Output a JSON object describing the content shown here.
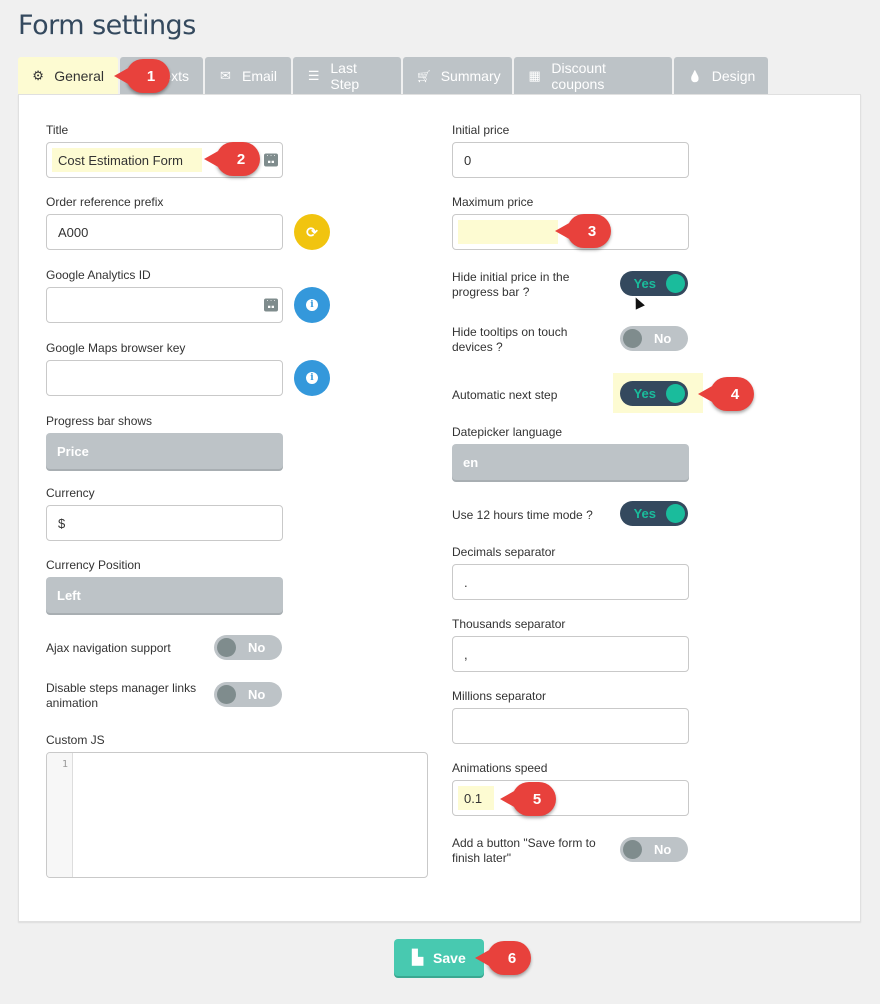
{
  "page": {
    "title": "Form settings"
  },
  "tabs": [
    {
      "label": "General",
      "icon": "gear-icon",
      "glyph": "⚙",
      "active": true
    },
    {
      "label": "Texts",
      "icon": "text-icon",
      "glyph": "",
      "active": false
    },
    {
      "label": "Email",
      "icon": "envelope-icon",
      "glyph": "✉",
      "active": false
    },
    {
      "label": "Last Step",
      "icon": "list-icon",
      "glyph": "☰",
      "active": false
    },
    {
      "label": "Summary",
      "icon": "cart-icon",
      "glyph": "🛒",
      "active": false
    },
    {
      "label": "Discount coupons",
      "icon": "gift-icon",
      "glyph": "▦",
      "active": false
    },
    {
      "label": "Design",
      "icon": "droplet-icon",
      "glyph": "💧",
      "active": false
    }
  ],
  "left": {
    "title": {
      "label": "Title",
      "value": "Cost Estimation Form"
    },
    "order_prefix": {
      "label": "Order reference prefix",
      "value": "A000"
    },
    "ga_id": {
      "label": "Google Analytics ID",
      "value": ""
    },
    "maps_key": {
      "label": "Google Maps browser key",
      "value": ""
    },
    "progress_shows": {
      "label": "Progress bar shows",
      "value": "Price"
    },
    "currency": {
      "label": "Currency",
      "value": "$"
    },
    "currency_position": {
      "label": "Currency Position",
      "value": "Left"
    },
    "ajax_nav": {
      "label": "Ajax navigation support",
      "state": "No"
    },
    "disable_anim": {
      "label": "Disable steps manager links animation",
      "state": "No"
    },
    "custom_js": {
      "label": "Custom JS",
      "line": "1"
    }
  },
  "right": {
    "initial_price": {
      "label": "Initial price",
      "value": "0"
    },
    "max_price": {
      "label": "Maximum price",
      "value": ""
    },
    "hide_initial": {
      "label": "Hide initial price in the progress bar ?",
      "state": "Yes"
    },
    "hide_tooltips": {
      "label": "Hide tooltips on touch devices ?",
      "state": "No"
    },
    "auto_next": {
      "label": "Automatic next step",
      "state": "Yes"
    },
    "datepicker_lang": {
      "label": "Datepicker language",
      "value": "en"
    },
    "hours12": {
      "label": "Use 12 hours time mode ?",
      "state": "Yes"
    },
    "decimals_sep": {
      "label": "Decimals separator",
      "value": "."
    },
    "thousands_sep": {
      "label": "Thousands separator",
      "value": ","
    },
    "millions_sep": {
      "label": "Millions separator",
      "value": ""
    },
    "anim_speed": {
      "label": "Animations speed",
      "value": "0.1"
    },
    "save_later": {
      "label": "Add a button \"Save form to finish later\"",
      "state": "No"
    }
  },
  "save_button": {
    "label": "Save"
  },
  "callouts": [
    "1",
    "2",
    "3",
    "4",
    "5",
    "6"
  ],
  "colors": {
    "accent": "#1abc9c",
    "toggle_on": "#34495e",
    "toggle_off": "#bdc3c7",
    "highlight": "#fdfbd2",
    "callout": "#e8413c",
    "save": "#48c9b0"
  }
}
